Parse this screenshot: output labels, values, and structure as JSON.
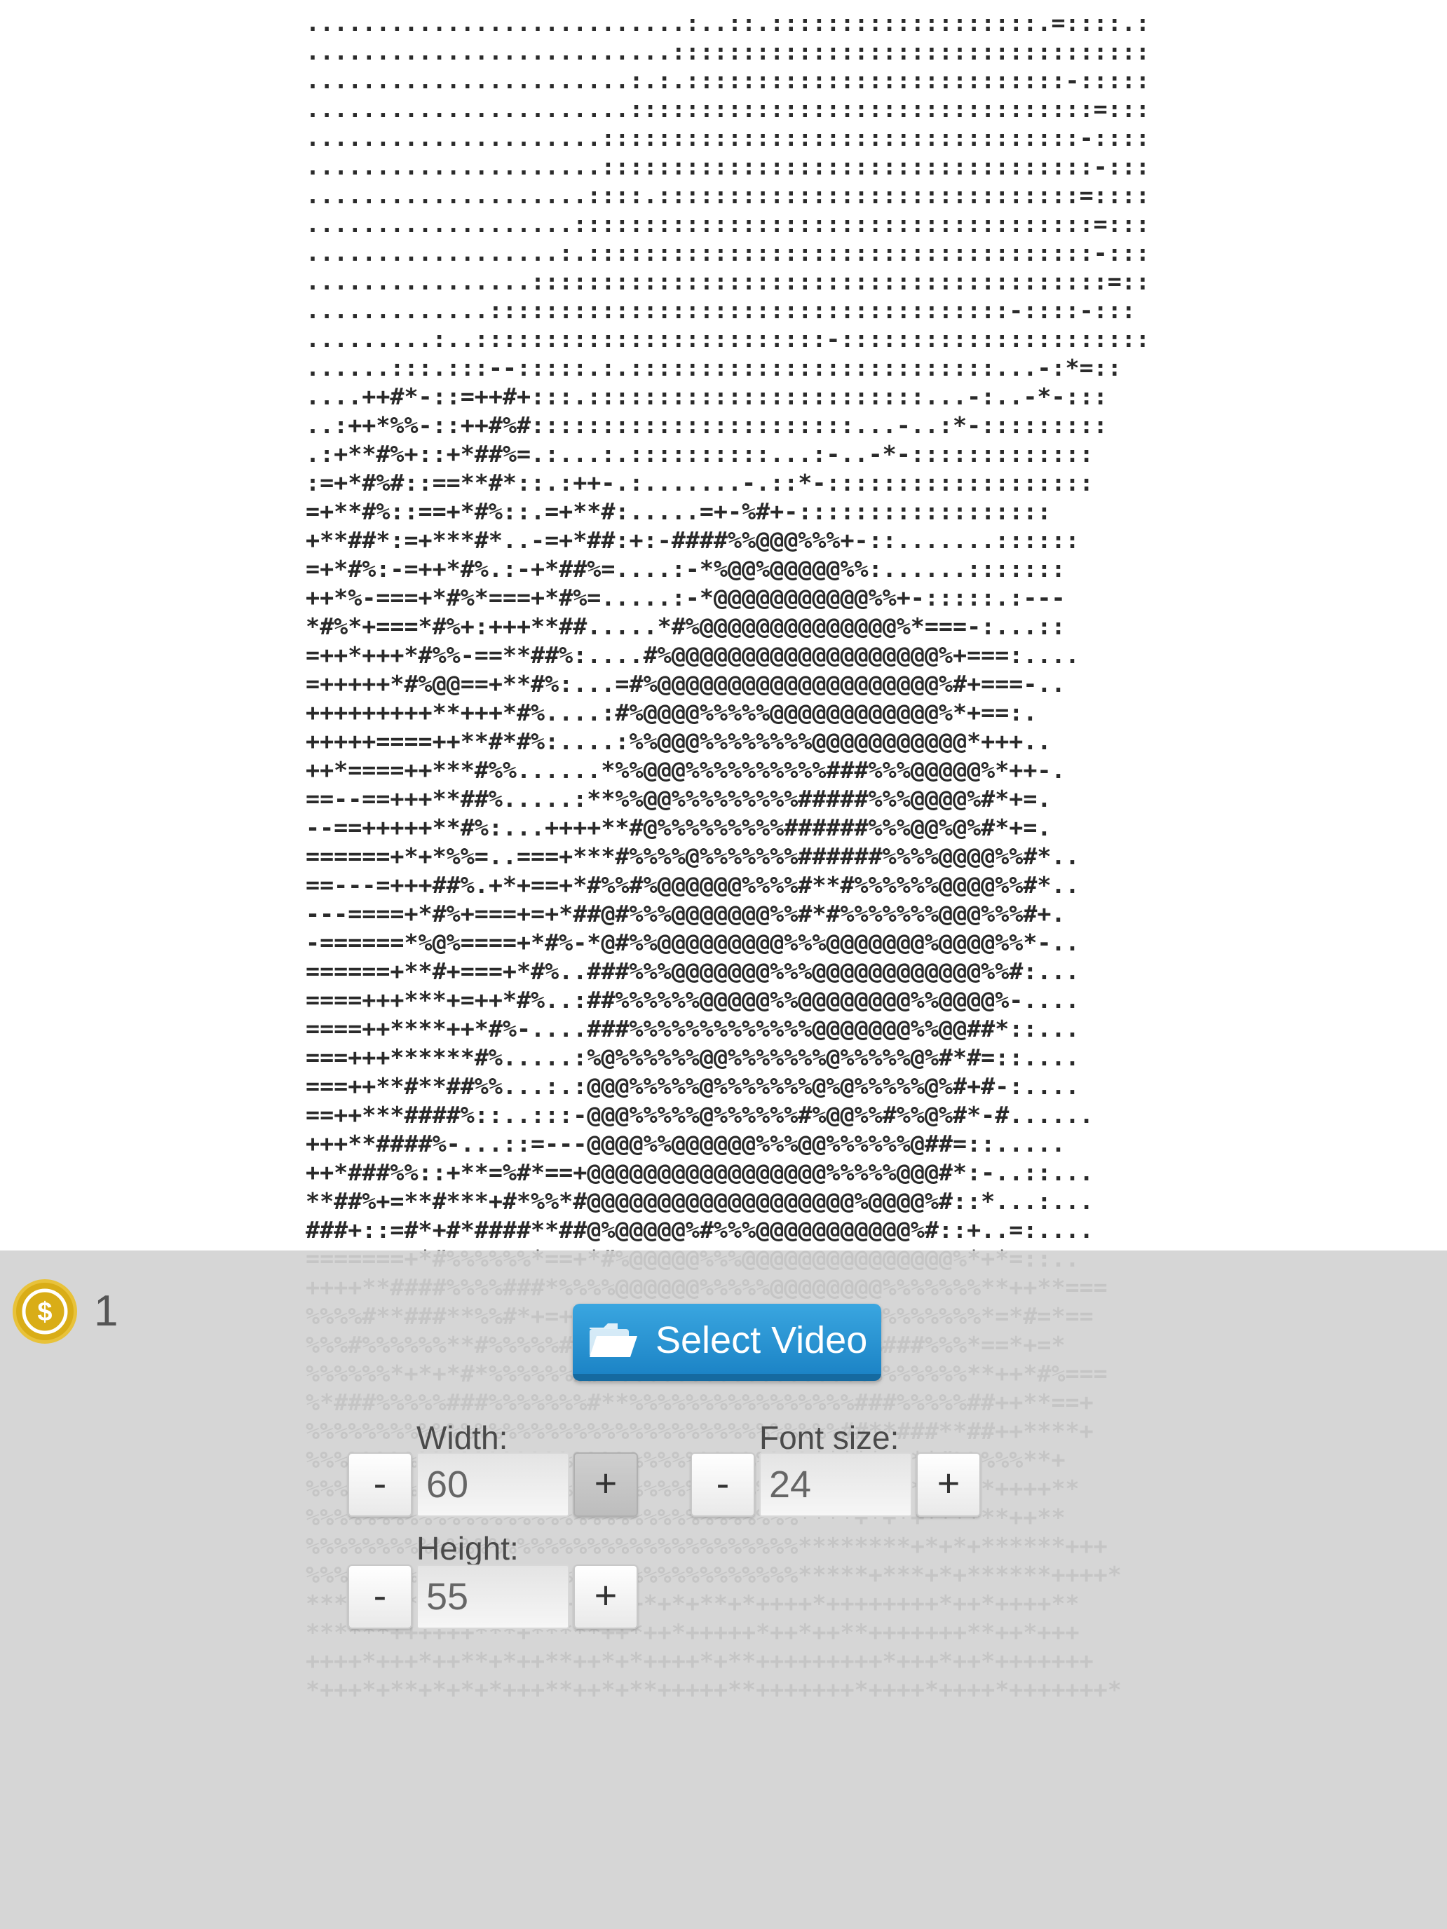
{
  "ascii_art": {
    "lines": [
      "...........................:..::.:::::::::::::::::::.=::::.:",
      "..........................:::::::::::::::::::::::::::::::::::",
      ".......................:.:.:::::::::::::::::::::::::::-:::::",
      ".......................:::::::::::::::::::::::::::::::::=::::",
      ".....................::::::::::::::::::::::::::::::::::-:::::",
      ".....................:::::::::::::::::::::::::::::::::::-::::",
      "....................::::.::::::::::::::::::::::::::::::=::::",
      "...................:::::::::::::::::::::::::::::::::::::=::::",
      "..................:.::::::::::::::::::::::::::::::::::::-:::",
      "................:::::::::::::::::::::::::::::::::::::::::=:::",
      ".............:::::::::::::::::::::::::::::::::::::-::::-:::",
      ".........:..:::::::::::::::::::::::::-::::::::::::::::::::::",
      "......:::.:::--:::::.:.::::::::::::::::::::::::::...-:*=::",
      "....++#*-::=++#+:::.::::::::::::::::::::::::...-:..-*-:::",
      "..:++*%%-::++#%#:::::::::::::::::::::::...-..:*-:::::::::",
      ".:+**#%+::+*##%=.:...:.::::::::::...:-..-*-:::::::::::::",
      ":=+*#%#::==**#*::.:++-.:.......-.::*-:::::::::::::::::::",
      "=+**#%::==+*#%::.=+**#:.....=+-%#+-::::::::::::::::::",
      "+**##*:=+***#*..-=+*##:+:-####%%@@@%%%+-::.......::::::",
      "=+*#%:-=++*#%.:-+*##%=....:-*%@@%@@@@@%%:......:::::::",
      "++*%-===+*#%*===+*#%=.....:-*@@@@@@@@@@@%%+-:::::.:---",
      "*#%*+===*#%+:+++**##.....*#%@@@@@@@@@@@@@@%*===-:...::",
      "=++*+++*#%%-==**##%:....#%@@@@@@@@@@@@@@@@@@@%+===:....",
      "=+++++*#%@@==+**#%:...=#%@@@@@@@@@@@@@@@@@@@@%#+===-..",
      "+++++++++**+++*#%....:#%@@@@%%%%%@@@@@@@@@@@@%*+==:.",
      "+++++====++**#*#%:....:%%@@@%%%%%%%%@@@@@@@@@@@*+++..",
      "++*====++***#%%......*%%@@@%%%%%%%%%%###%%%@@@@@%*++-.",
      "==--==+++**##%.....:**%%@@%%%%%%%%%#####%%%@@@@%#*+=.",
      "--==+++++**#%:...++++**#@%%%%%%%%%######%%%@@%@%#*+=.",
      "======+*+*%%=..===+***#%%%%@%%%%%%%######%%%%@@@@%%#*..",
      "==---=+++##%.+*+==+*#%%#%@@@@@@%%%%#**#%%%%%%@@@@%%#*..",
      "---====+*#%+===+=+*##@#%%%@@@@@@@%%#*#%%%%%%%@@@%%%#+.",
      "-======*%@%====+*#%-*@#%%@@@@@@@@@%%%@@@@@@@%@@@@%%*-..",
      "======+**#+===+*#%..###%%%@@@@@@@%%%@@@@@@@@@@@@%%#:...",
      "====+++***+=++*#%..:##%%%%%%@@@@@%%@@@@@@@@%%@@@@%-....",
      "====++****++*#%-....###%%%%%%%%%%%%%@@@@@@@%%@@##*::...",
      "===+++******#%.....:%@%%%%%%@@%%%%%%%@%%%%%@%#*#=::....",
      "===++**#**##%%...:.:@@@%%%%%@%%%%%%%@%@%%%%%@%#+#-:....",
      "==++***####%::..:::-@@@%%%%%@%%%%%%#%@@%%#%%@%#*-#......",
      "+++**####%-...::=---@@@@%%@@@@@@%%%@@%%%%%%@##=::.....",
      "++*###%%::+**=%#*==+@@@@@@@@@@@@@@@@@%%%%%@@@#*:-..::...",
      "**##%+=**#***+#*%%*#@@@@@@@@@@@@@@@@@@@%@@@@%#::*...:...",
      "###+::=#*+#*####**##@%@@@@@%#%%%@@@@@@@@@@@%#::+..=:....",
      "=======+*#%%%%%%*==+*#%@@@@@%%%@@@@@@@@@@@@@@@%*+*=::..",
      "++++**####%%%%###*%%%%@@@@@@%%%%%@@@@@@@@%%%%%%%**++**===",
      "%%%%#**###**%%#*+=+*#%%%@@@@@@@@%%%%@@@@@%%%%%%%*=*#=*==",
      "%%%#%%%%%%**#%%%%%##%%%%%%%@@%%%%%@@%%%%%###%%%*==*+=*",
      "%%%%%%*+*+*#*%%%%%%##%%%%%%%%%%%%%%%%%%%%%%%%%%**++*#%===",
      "%*###%%%%%###%%%%%%%#**%%%%%%%%%%%%%%%%###%%%%%##++**==+",
      "%%%%%%%%%%%%%%%%%%%%%%%%%%%%%%%%%%%%%%##**###**##++****+",
      "%%%%%%%%%%%%%%%%%%%%%%%%%%%%%%%%%%%%*****++**#%%%%%**+",
      "%%%%%%%%%%%%%%%%%%%%%%%%%%%%%%%%%%*==**+****++*+*++++**",
      "%%%%%%%%%%%%%%%%%%%%%%%%%%%%%%%%%%%****+*+*+******++**",
      "%%%%%%%%%%%%%%%%%%%%%%%%%%%%%%%%%%%********+*+*+******+++",
      "%%%%%%%%%%%%%%%%%%%%%%%%%%%%%%%%%%%*****+***+*+******++++*",
      "********+**+++*++*++**++*+*+**+*++++*++++++++*++*++++**",
      "******++++++***+*****++*++*+++++*++*++**+++++++**++*+++",
      "++++*+++*++**+*++**++*+*++++*+**+++++++++*+++*++*+++++++",
      "*+++*+**+*+*+*+++**++*+**+++++**+++++++*++++*++++*+++++++*"
    ]
  },
  "coins": {
    "icon": "dollar-coin-icon",
    "count": "1"
  },
  "select_video": {
    "label": "Select Video",
    "icon": "folder-icon"
  },
  "width_control": {
    "label": "Width:",
    "value": "60",
    "minus": "-",
    "plus": "+"
  },
  "font_size_control": {
    "label": "Font size:",
    "value": "24",
    "minus": "-",
    "plus": "+"
  },
  "height_control": {
    "label": "Height:",
    "value": "55",
    "minus": "-",
    "plus": "+"
  },
  "colors": {
    "panel": "#d2d2d2",
    "button_blue": "#2196d8",
    "coin_gold": "#d9ad17"
  }
}
